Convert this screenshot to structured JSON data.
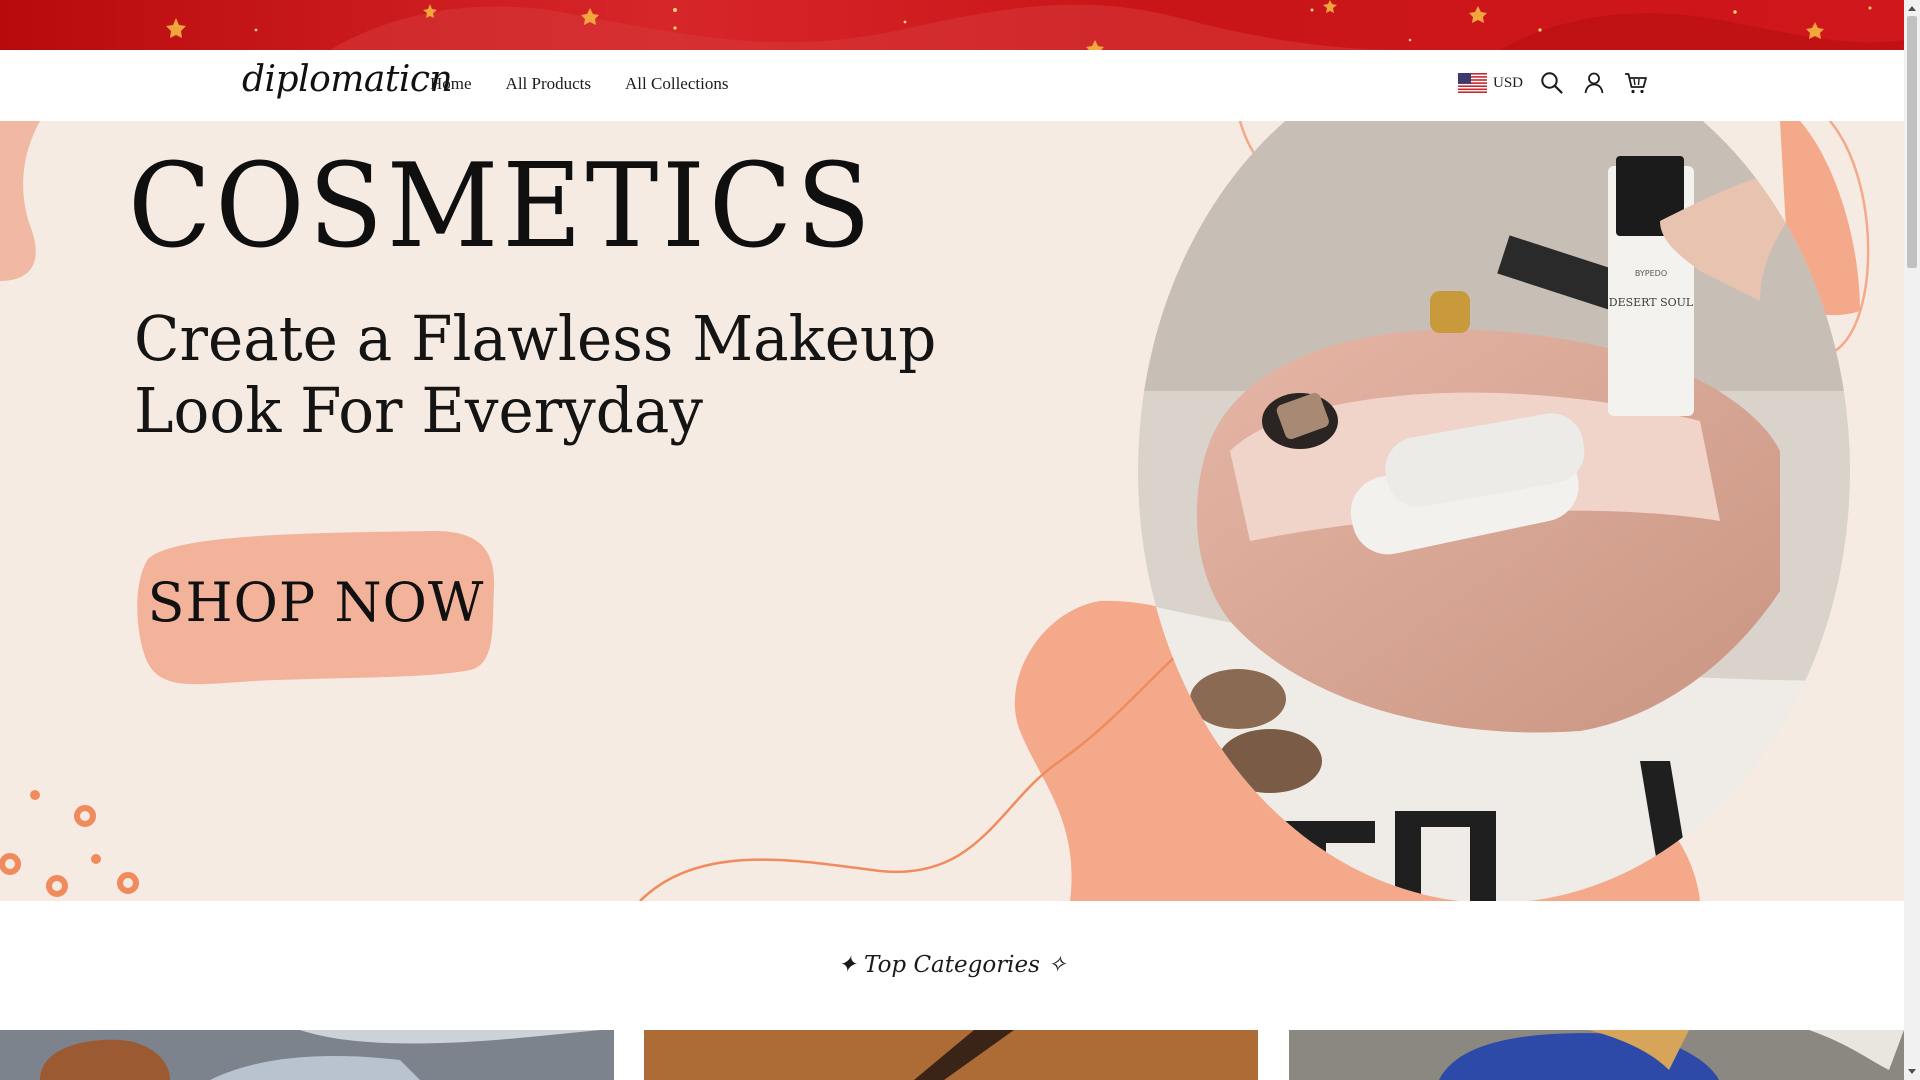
{
  "header": {
    "logo": "diplomaticn",
    "nav": [
      "Home",
      "All Products",
      "All Collections"
    ],
    "currency": "USD",
    "icons": [
      "us-flag-icon",
      "search-icon",
      "account-icon",
      "cart-icon"
    ]
  },
  "hero": {
    "title": "COSMETICS",
    "subtitle_line1": "Create a Flawless Makeup",
    "subtitle_line2": "Look For Everyday",
    "cta": "SHOP NOW",
    "photo_text_bottle_brand": "BYPEDO",
    "photo_text_bottle_name": "DESERT SOUL"
  },
  "categories": {
    "heading": "✦ Top Categories ✧"
  },
  "colors": {
    "promo_red": "#c8161a",
    "hero_bg": "#f6ebe2",
    "accent_peach": "#f4a98a",
    "button_peach": "#f3b39b"
  }
}
